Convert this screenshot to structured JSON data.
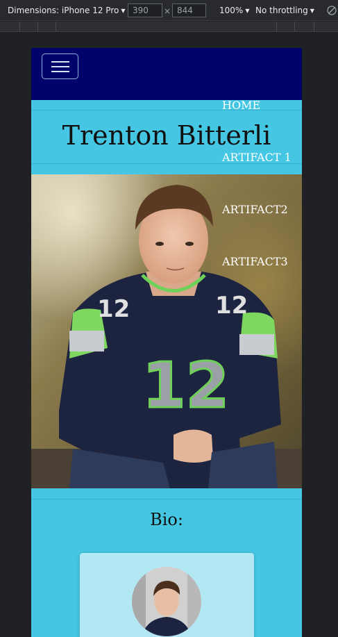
{
  "devtools": {
    "dimensions_label": "Dimensions: iPhone 12 Pro",
    "width_value": "390",
    "times": "×",
    "height_value": "844",
    "zoom": "100%",
    "throttle": "No throttling"
  },
  "site": {
    "nav": {
      "items": [
        "HOME",
        "ARTIFACT 1",
        "ARTIFACT2",
        "ARTIFACT3"
      ]
    },
    "hero_title": "Trenton Bitterli",
    "bio_heading": "Bio:"
  },
  "colors": {
    "navbar": "#02026b",
    "page_bg": "#45c7e3",
    "card_bg": "#b2e8f4"
  }
}
